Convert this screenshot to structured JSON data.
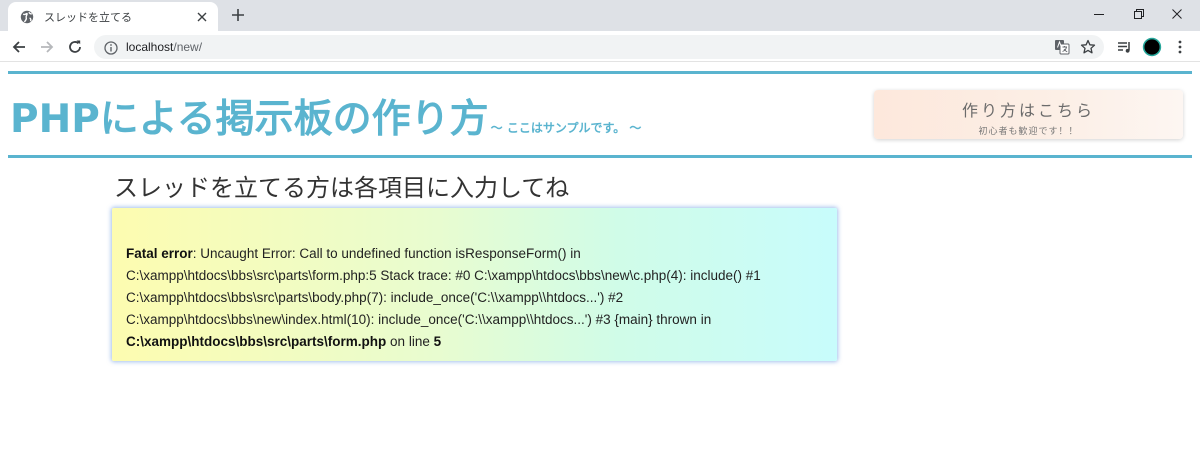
{
  "browser": {
    "tab_title": "スレッドを立てる",
    "url_host": "localhost",
    "url_path": "/new/"
  },
  "page": {
    "site_title": "PHPによる掲示板の作り方",
    "site_subtitle": "～ ここはサンプルです。 ～",
    "howto_button": {
      "main": "作り方はこちら",
      "sub": "初心者も歓迎です！！"
    },
    "form_heading": "スレッドを立てる方は各項目に入力してね",
    "error": {
      "label": "Fatal error",
      "line1": ": Uncaught Error: Call to undefined function isResponseForm() in",
      "line2": "C:\\xampp\\htdocs\\bbs\\src\\parts\\form.php:5 Stack trace: #0 C:\\xampp\\htdocs\\bbs\\new\\c.php(4): include() #1",
      "line3": "C:\\xampp\\htdocs\\bbs\\src\\parts\\body.php(7): include_once('C:\\\\xampp\\\\htdocs...') #2",
      "line4": "C:\\xampp\\htdocs\\bbs\\new\\index.html(10): include_once('C:\\\\xampp\\\\htdocs...') #3 {main} thrown in",
      "file": "C:\\xampp\\htdocs\\bbs\\src\\parts\\form.php",
      "on_line_text": " on line ",
      "line_number": "5"
    }
  },
  "colors": {
    "accent": "#5ab4cf",
    "tabstrip": "#dee1e6"
  }
}
